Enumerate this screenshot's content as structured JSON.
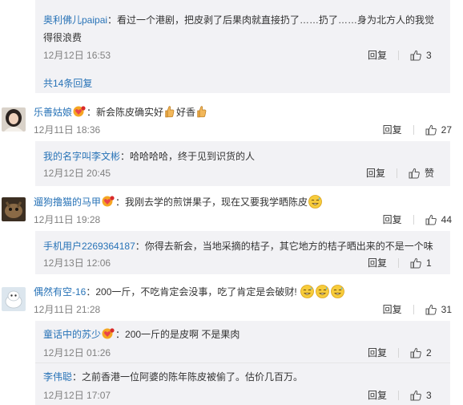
{
  "thread0": {
    "replies": [
      {
        "user": "奥利佛儿paipai",
        "text": "：看过一个港剧，把皮剥了后果肉就直接扔了……扔了……身为北方人的我觉得很浪费",
        "time": "12月12日 16:53",
        "reply": "回复",
        "likes": "3"
      }
    ],
    "more": "共14条回复"
  },
  "comments": [
    {
      "user": "乐善姑娘",
      "text_a": "：新会陈皮确实好",
      "text_b": "好香",
      "time": "12月11日 18:36",
      "reply": "回复",
      "likes": "27",
      "replies": [
        {
          "user": "我的名字叫李文彬",
          "text": "：哈哈哈哈，终于见到识货的人",
          "time": "12月12日 20:45",
          "reply": "回复",
          "likes": "赞"
        }
      ]
    },
    {
      "user": "遛狗撸猫的马甲",
      "text": "：我刚去学的煎饼果子，现在又要我学晒陈皮",
      "time": "12月11日 19:28",
      "reply": "回复",
      "likes": "44",
      "replies": [
        {
          "user": "手机用户2269364187",
          "text": "：你得去新会，当地采摘的桔子，其它地方的桔子晒出来的不是一个味",
          "time": "12月13日 12:06",
          "reply": "回复",
          "likes": "1"
        }
      ]
    },
    {
      "user": "偶然有空-16",
      "text": "：200一斤，不吃肯定会没事，吃了肯定是会破财!",
      "time": "12月11日 21:28",
      "reply": "回复",
      "likes": "31",
      "replies": [
        {
          "user": "童话中的苏少",
          "text": "：200一斤的是皮啊 不是果肉",
          "time": "12月12日 01:26",
          "reply": "回复",
          "likes": "2"
        },
        {
          "user": "李伟聪",
          "text": "：之前香港一位阿婆的陈年陈皮被偷了。估价几百万。",
          "time": "12月12日 17:07",
          "reply": "回复",
          "likes": "3"
        }
      ]
    }
  ],
  "icons": {
    "like": "thumbs-up-icon",
    "badge": "heart-badge-icon",
    "emoji": "sweat-smile-emoji",
    "hand": "thumbs-up-hand-emoji"
  },
  "colors": {
    "link": "#2873b7",
    "meta": "#808080",
    "sub_bg": "#f2f2f5"
  }
}
